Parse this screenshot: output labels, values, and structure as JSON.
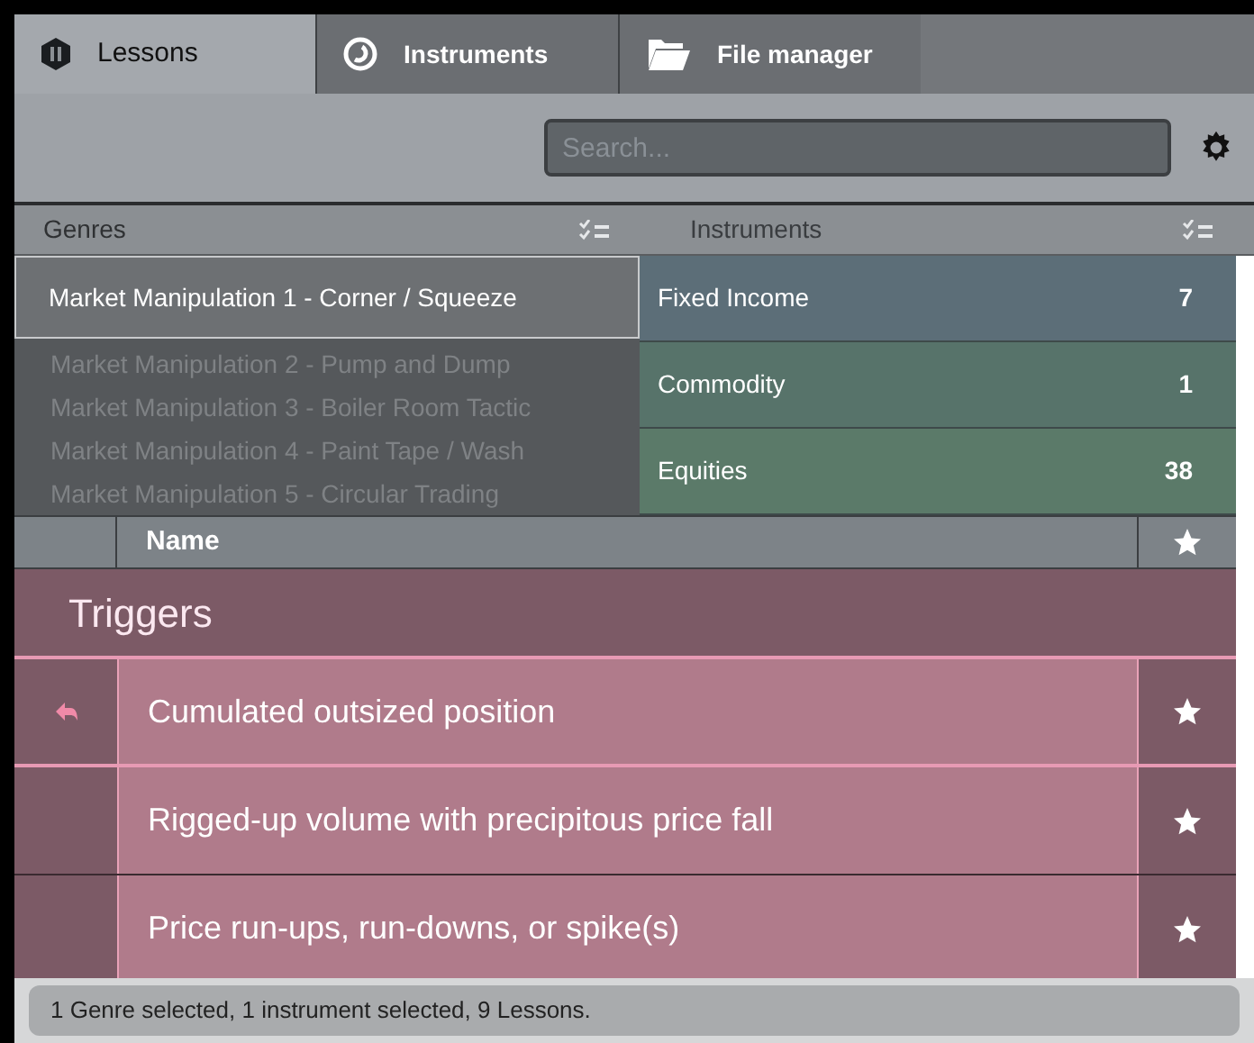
{
  "tabs": [
    {
      "label": "Lessons",
      "selected": true
    },
    {
      "label": "Instruments",
      "selected": false
    },
    {
      "label": "File manager",
      "selected": false
    }
  ],
  "search": {
    "placeholder": "Search..."
  },
  "genres": {
    "title": "Genres",
    "items": [
      {
        "label": "Market Manipulation 1 - Corner / Squeeze",
        "selected": true
      },
      {
        "label": "Market Manipulation 2 - Pump and Dump",
        "selected": false
      },
      {
        "label": "Market Manipulation 3 - Boiler Room Tactic",
        "selected": false
      },
      {
        "label": "Market Manipulation 4 - Paint Tape / Wash",
        "selected": false
      },
      {
        "label": "Market Manipulation 5 - Circular Trading",
        "selected": false
      }
    ]
  },
  "instruments": {
    "title": "Instruments",
    "items": [
      {
        "label": "Fixed Income",
        "count": "7",
        "color": "#5c6e78"
      },
      {
        "label": "Commodity",
        "count": "1",
        "color": "#57736a"
      },
      {
        "label": "Equities",
        "count": "38",
        "color": "#5b7a69"
      }
    ]
  },
  "lessons": {
    "columns": [
      "Name"
    ],
    "group": "Triggers",
    "rows": [
      {
        "name": "Cumulated outsized position",
        "flagged": true
      },
      {
        "name": "Rigged-up volume with precipitous price fall",
        "flagged": false
      },
      {
        "name": "Price run-ups, run-downs, or spike(s)",
        "flagged": false
      }
    ]
  },
  "status_bar": "1 Genre selected, 1 instrument selected, 9 Lessons."
}
